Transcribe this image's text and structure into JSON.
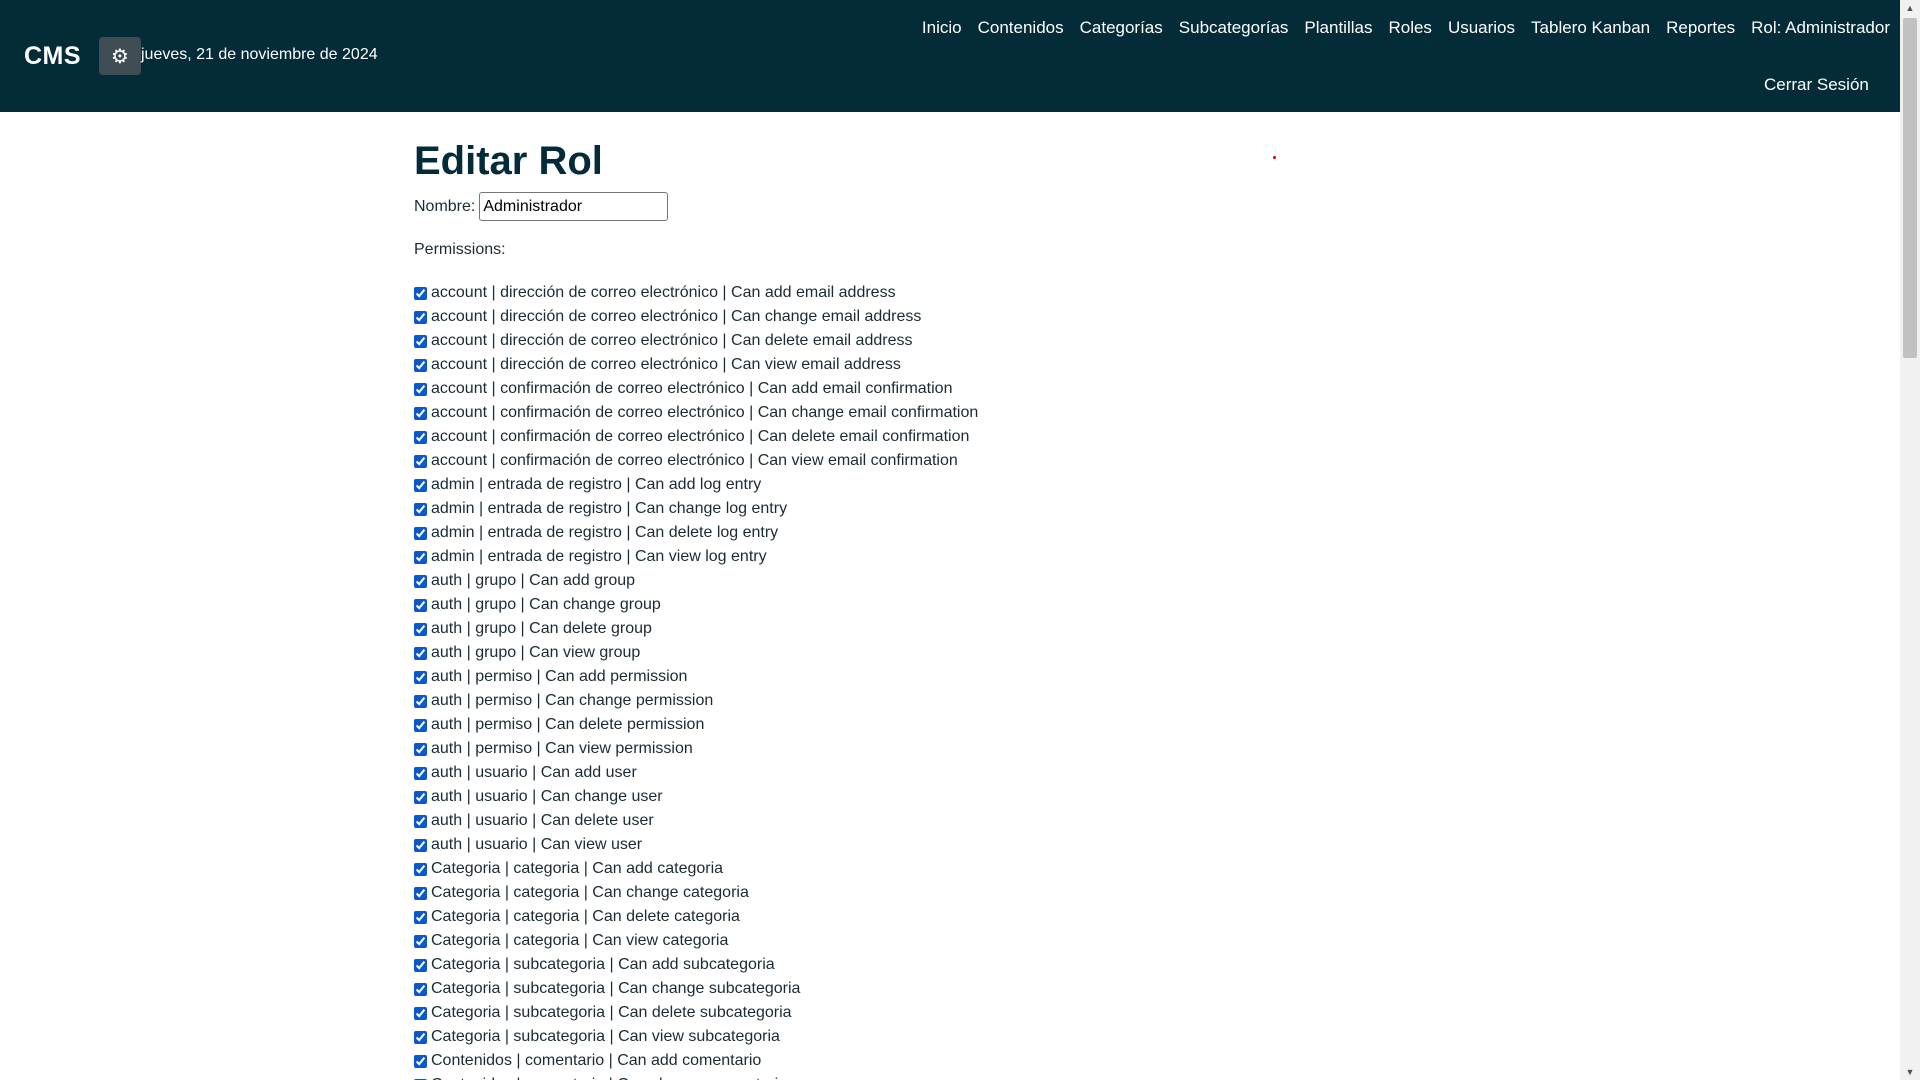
{
  "header": {
    "brand": "CMS",
    "settings_icon": "gear-icon",
    "date": "jueves, 21 de noviembre de 2024",
    "nav": [
      "Inicio",
      "Contenidos",
      "Categorías",
      "Subcategorías",
      "Plantillas",
      "Roles",
      "Usuarios",
      "Tablero Kanban",
      "Reportes",
      "Rol: Administrador"
    ],
    "logout": "Cerrar Sesión",
    "background_color": "#032b38"
  },
  "main": {
    "title": "Editar Rol",
    "name_label": "Nombre:",
    "name_value": "Administrador",
    "permissions_label": "Permissions:",
    "permissions": [
      {
        "label": "account | dirección de correo electrónico | Can add email address",
        "checked": true
      },
      {
        "label": "account | dirección de correo electrónico | Can change email address",
        "checked": true
      },
      {
        "label": "account | dirección de correo electrónico | Can delete email address",
        "checked": true
      },
      {
        "label": "account | dirección de correo electrónico | Can view email address",
        "checked": true
      },
      {
        "label": "account | confirmación de correo electrónico | Can add email confirmation",
        "checked": true
      },
      {
        "label": "account | confirmación de correo electrónico | Can change email confirmation",
        "checked": true
      },
      {
        "label": "account | confirmación de correo electrónico | Can delete email confirmation",
        "checked": true
      },
      {
        "label": "account | confirmación de correo electrónico | Can view email confirmation",
        "checked": true
      },
      {
        "label": "admin | entrada de registro | Can add log entry",
        "checked": true
      },
      {
        "label": "admin | entrada de registro | Can change log entry",
        "checked": true
      },
      {
        "label": "admin | entrada de registro | Can delete log entry",
        "checked": true
      },
      {
        "label": "admin | entrada de registro | Can view log entry",
        "checked": true
      },
      {
        "label": "auth | grupo | Can add group",
        "checked": true
      },
      {
        "label": "auth | grupo | Can change group",
        "checked": true
      },
      {
        "label": "auth | grupo | Can delete group",
        "checked": true
      },
      {
        "label": "auth | grupo | Can view group",
        "checked": true
      },
      {
        "label": "auth | permiso | Can add permission",
        "checked": true
      },
      {
        "label": "auth | permiso | Can change permission",
        "checked": true
      },
      {
        "label": "auth | permiso | Can delete permission",
        "checked": true
      },
      {
        "label": "auth | permiso | Can view permission",
        "checked": true
      },
      {
        "label": "auth | usuario | Can add user",
        "checked": true
      },
      {
        "label": "auth | usuario | Can change user",
        "checked": true
      },
      {
        "label": "auth | usuario | Can delete user",
        "checked": true
      },
      {
        "label": "auth | usuario | Can view user",
        "checked": true
      },
      {
        "label": "Categoria | categoria | Can add categoria",
        "checked": true
      },
      {
        "label": "Categoria | categoria | Can change categoria",
        "checked": true
      },
      {
        "label": "Categoria | categoria | Can delete categoria",
        "checked": true
      },
      {
        "label": "Categoria | categoria | Can view categoria",
        "checked": true
      },
      {
        "label": "Categoria | subcategoria | Can add subcategoria",
        "checked": true
      },
      {
        "label": "Categoria | subcategoria | Can change subcategoria",
        "checked": true
      },
      {
        "label": "Categoria | subcategoria | Can delete subcategoria",
        "checked": true
      },
      {
        "label": "Categoria | subcategoria | Can view subcategoria",
        "checked": true
      },
      {
        "label": "Contenidos | comentario | Can add comentario",
        "checked": true
      },
      {
        "label": "Contenidos | comentario | Can change comentario",
        "checked": true
      }
    ]
  }
}
